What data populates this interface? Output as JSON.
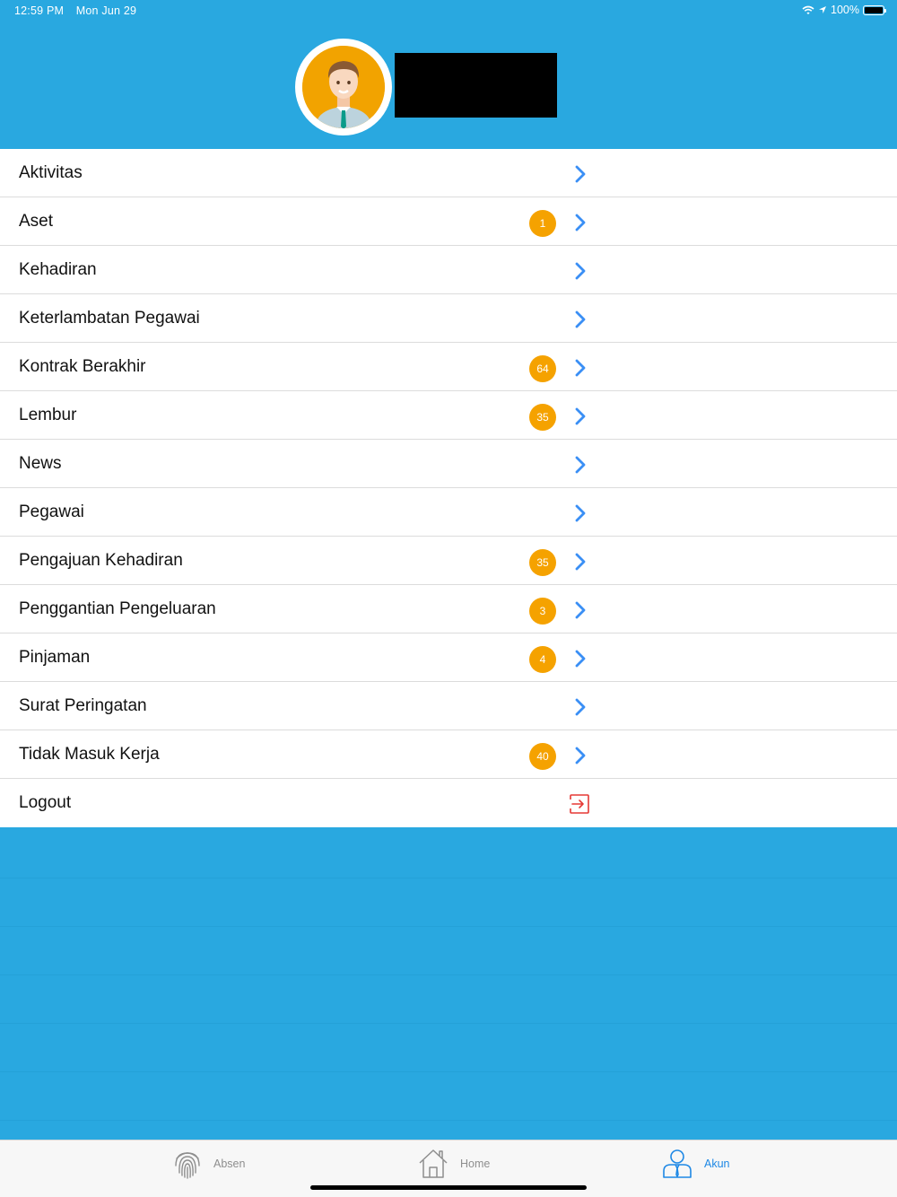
{
  "status": {
    "time": "12:59 PM",
    "date": "Mon Jun 29",
    "battery": "100%"
  },
  "header": {
    "avatar_icon": "user-avatar-icon"
  },
  "menu": {
    "items": [
      {
        "label": "Aktivitas",
        "badge": ""
      },
      {
        "label": "Aset",
        "badge": "1"
      },
      {
        "label": "Kehadiran",
        "badge": ""
      },
      {
        "label": "Keterlambatan Pegawai",
        "badge": ""
      },
      {
        "label": "Kontrak Berakhir",
        "badge": "64"
      },
      {
        "label": "Lembur",
        "badge": "35"
      },
      {
        "label": "News",
        "badge": ""
      },
      {
        "label": "Pegawai",
        "badge": ""
      },
      {
        "label": "Pengajuan Kehadiran",
        "badge": "35"
      },
      {
        "label": "Penggantian Pengeluaran",
        "badge": "3"
      },
      {
        "label": "Pinjaman",
        "badge": "4"
      },
      {
        "label": "Surat Peringatan",
        "badge": ""
      },
      {
        "label": "Tidak Masuk Kerja",
        "badge": "40"
      }
    ],
    "logout": {
      "label": "Logout",
      "icon": "logout-icon"
    }
  },
  "tabbar": {
    "tabs": [
      {
        "label": "Absen",
        "icon": "fingerprint-icon",
        "active": false
      },
      {
        "label": "Home",
        "icon": "home-icon",
        "active": false
      },
      {
        "label": "Akun",
        "icon": "account-icon",
        "active": true
      }
    ]
  },
  "colors": {
    "primary": "#29a8e0",
    "badge": "#f5a200",
    "chevron": "#3a8ff5",
    "logout": "#e53935",
    "active_tab": "#1e88e5",
    "inactive_tab": "#8e8e8e"
  }
}
